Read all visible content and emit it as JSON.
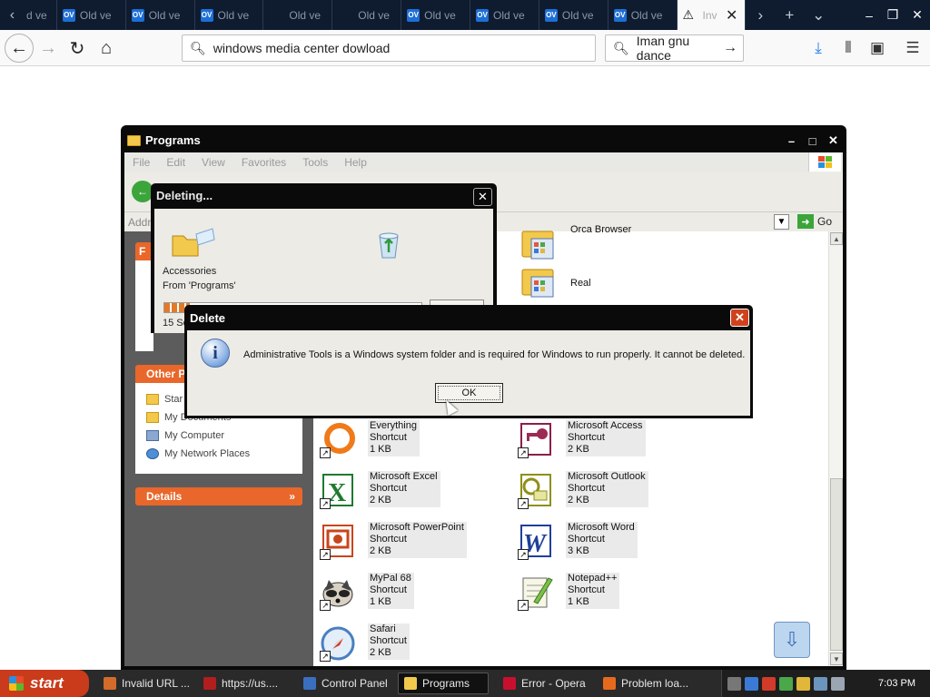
{
  "browser": {
    "tabs": [
      {
        "label": "Old ve",
        "favicon": "ov"
      },
      {
        "label": "Old ve",
        "favicon": "ov"
      },
      {
        "label": "Old ve",
        "favicon": "ov"
      },
      {
        "label": "Old ve",
        "favicon": "ov"
      },
      {
        "label": "Old ve",
        "favicon": ""
      },
      {
        "label": "Old ve",
        "favicon": ""
      },
      {
        "label": "Old ve",
        "favicon": "ov"
      },
      {
        "label": "Old ve",
        "favicon": "ov"
      },
      {
        "label": "Old ve",
        "favicon": "ov"
      },
      {
        "label": "Old ve",
        "favicon": "ov"
      }
    ],
    "first_tab_partial": "d ve",
    "active_tab": {
      "label": "Inv"
    },
    "url": "windows media center dowload",
    "search": "Iman gnu dance"
  },
  "explorer": {
    "title": "Programs",
    "menu": [
      "File",
      "Edit",
      "View",
      "Favorites",
      "Tools",
      "Help"
    ],
    "address_label": "Addr",
    "go_label": "Go",
    "left_panel": {
      "top_head": "F",
      "other_places_head": "Other P",
      "other_places": [
        "Star",
        "My Documents",
        "My Computer",
        "My Network Places"
      ],
      "details_head": "Details"
    },
    "files": [
      {
        "name": "Orca Browser",
        "type": "",
        "size": ""
      },
      {
        "name": "Real",
        "type": "",
        "size": ""
      },
      {
        "name": "Everything",
        "type": "Shortcut",
        "size": "1 KB"
      },
      {
        "name": "Microsoft Access",
        "type": "Shortcut",
        "size": "2 KB"
      },
      {
        "name": "Microsoft Excel",
        "type": "Shortcut",
        "size": "2 KB"
      },
      {
        "name": "Microsoft Outlook",
        "type": "Shortcut",
        "size": "2 KB"
      },
      {
        "name": "Microsoft PowerPoint",
        "type": "Shortcut",
        "size": "2 KB"
      },
      {
        "name": "Microsoft Word",
        "type": "Shortcut",
        "size": "3 KB"
      },
      {
        "name": "MyPal 68",
        "type": "Shortcut",
        "size": "1 KB"
      },
      {
        "name": "Notepad++",
        "type": "Shortcut",
        "size": "1 KB"
      },
      {
        "name": "Safari",
        "type": "Shortcut",
        "size": "2 KB"
      }
    ]
  },
  "deleting_dialog": {
    "title": "Deleting...",
    "item": "Accessories",
    "from": "From 'Programs'",
    "time": "15 Se",
    "progress": 0.1
  },
  "delete_dialog": {
    "title": "Delete",
    "message": "Administrative Tools is a Windows system folder and is required for Windows to run properly. It cannot be deleted.",
    "ok": "OK"
  },
  "taskbar": {
    "start": "start",
    "tasks": [
      {
        "label": "Invalid URL ...",
        "color": "#d36b2a"
      },
      {
        "label": "https://us....",
        "color": "#b01e1e"
      },
      {
        "label": "Control Panel",
        "color": "#3a6fc0"
      },
      {
        "label": "Programs",
        "color": "#f2c94c"
      },
      {
        "label": "Error - Opera",
        "color": "#c8102e"
      },
      {
        "label": "Problem loa...",
        "color": "#e66a1e"
      }
    ],
    "active_task": 3,
    "clock": "7:03 PM"
  }
}
